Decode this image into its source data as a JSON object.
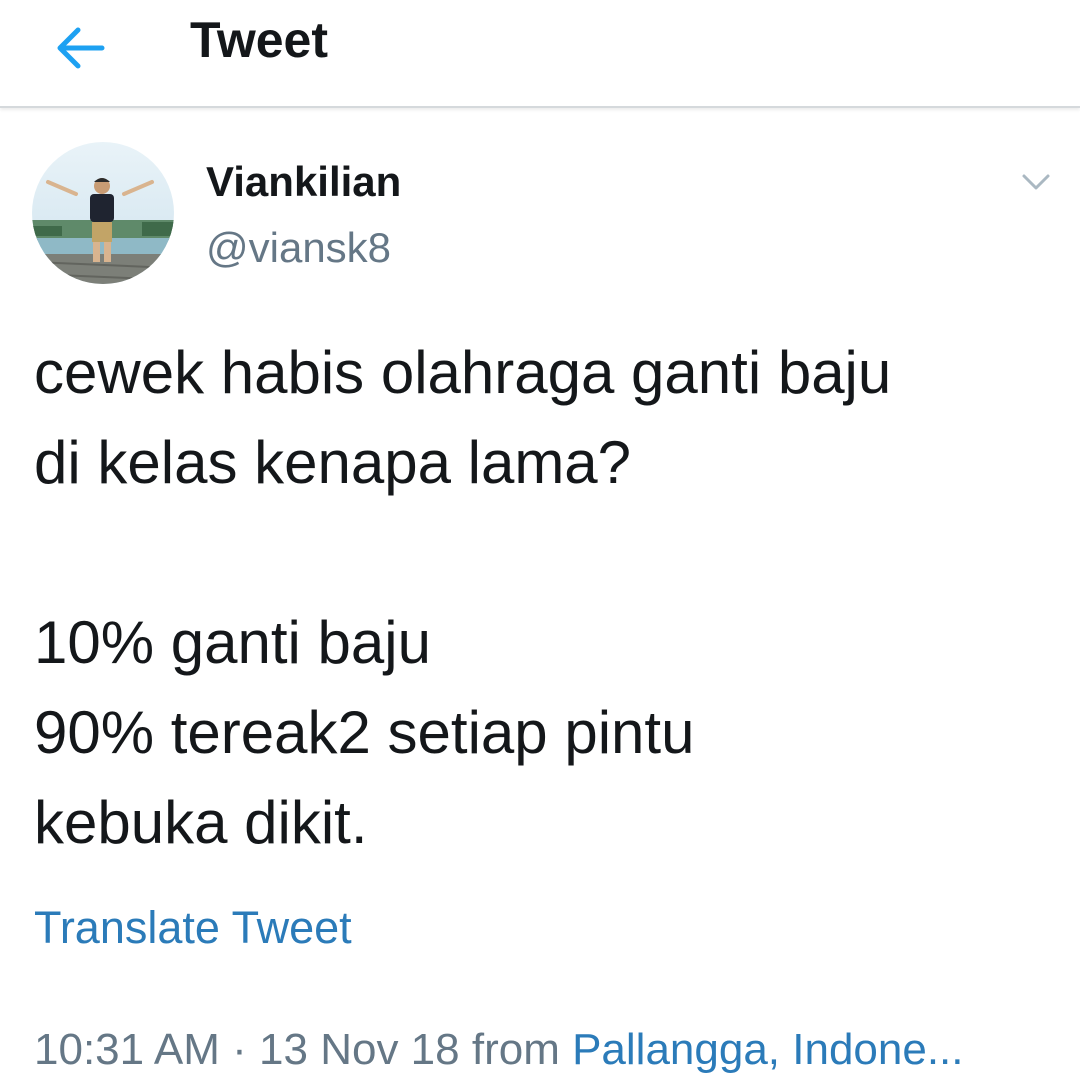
{
  "header": {
    "title": "Tweet",
    "back_icon": "arrow-left-icon",
    "accent": "#1da1f2"
  },
  "author": {
    "display_name": "Viankilian",
    "handle": "@viansk8",
    "menu_icon": "chevron-down-icon"
  },
  "tweet": {
    "lines": [
      "cewek habis olahraga ganti baju",
      "di kelas kenapa lama?",
      "",
      "10% ganti baju",
      "90% tereak2 setiap pintu",
      "kebuka dikit."
    ],
    "translate_label": "Translate Tweet"
  },
  "meta": {
    "time": "10:31 AM",
    "separator": "·",
    "date": "13 Nov 18",
    "from": "from",
    "location": "Pallangga, Indone..."
  },
  "colors": {
    "text": "#14171a",
    "secondary": "#657786",
    "link": "#2b7bb9"
  }
}
